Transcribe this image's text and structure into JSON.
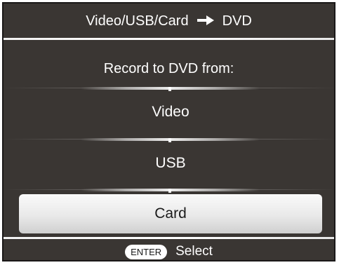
{
  "header": {
    "source": "Video/USB/Card",
    "arrow_icon": "right-arrow-icon",
    "destination": "DVD"
  },
  "prompt": "Record to DVD from:",
  "menu": {
    "items": [
      {
        "label": "Video",
        "selected": false
      },
      {
        "label": "USB",
        "selected": false
      },
      {
        "label": "Card",
        "selected": true
      }
    ]
  },
  "footer": {
    "key_label": "ENTER",
    "action_label": "Select"
  },
  "colors": {
    "background": "#3a3633",
    "text": "#ffffff",
    "selected_background": "#ececec",
    "selected_text": "#1a1a1a"
  }
}
